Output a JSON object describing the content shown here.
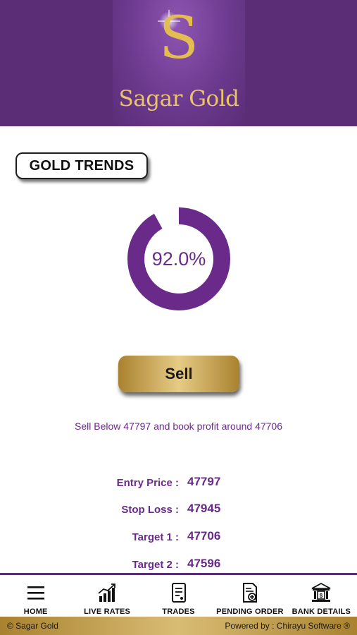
{
  "brand": {
    "logo_letter": "S",
    "name": "Sagar Gold"
  },
  "section": {
    "title": "GOLD TRENDS"
  },
  "trend": {
    "percent": 92.0,
    "percent_label": "92.0%",
    "ring_color": "#6a2a8a"
  },
  "action": {
    "label": "Sell"
  },
  "advice": {
    "text": "Sell Below 47797 and book profit around 47706"
  },
  "levels": [
    {
      "label": "Entry Price :",
      "value": "47797"
    },
    {
      "label": "Stop Loss :",
      "value": "47945"
    },
    {
      "label": "Target 1 :",
      "value": "47706"
    },
    {
      "label": "Target 2 :",
      "value": "47596"
    }
  ],
  "nav": [
    {
      "label": "HOME",
      "icon": "menu-icon"
    },
    {
      "label": "LIVE RATES",
      "icon": "bar-chart-icon"
    },
    {
      "label": "TRADES",
      "icon": "document-icon"
    },
    {
      "label": "PENDING ORDER",
      "icon": "add-document-icon"
    },
    {
      "label": "BANK DETAILS",
      "icon": "bank-icon"
    }
  ],
  "footer": {
    "copyright": "© Sagar Gold",
    "powered_by": "Powered by : Chirayu Software ®"
  },
  "colors": {
    "brand_purple": "#5b2d77",
    "accent_purple": "#6a2a8a",
    "gold": "#d4b25f"
  }
}
